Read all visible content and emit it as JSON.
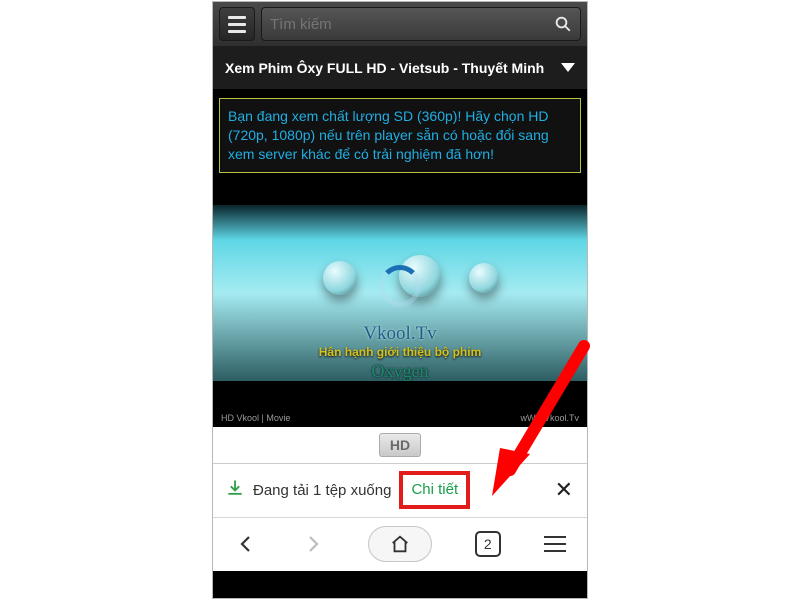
{
  "header": {
    "search_placeholder": "Tìm kiếm"
  },
  "title": "Xem Phim Ôxy FULL HD - Vietsub - Thuyết Minh",
  "notice": "Bạn đang xem chất lượng SD (360p)! Hãy chọn HD (720p, 1080p) nếu trên player sẵn có hoặc đổi sang xem server khác để có trải nghiệm đã hơn!",
  "video": {
    "watermark_script": "Vkool.Tv",
    "watermark_sub": "Hân hạnh giới thiệu bộ phim",
    "watermark_title": "Oxygen",
    "corner_left": "HD Vkool | Movie",
    "corner_right": "wWw.Vkool.Tv"
  },
  "tabs": {
    "hd_label": "HD"
  },
  "download": {
    "text": "Đang tải 1 tệp xuống",
    "link": "Chi tiết"
  },
  "bottomnav": {
    "tab_count": "2"
  }
}
